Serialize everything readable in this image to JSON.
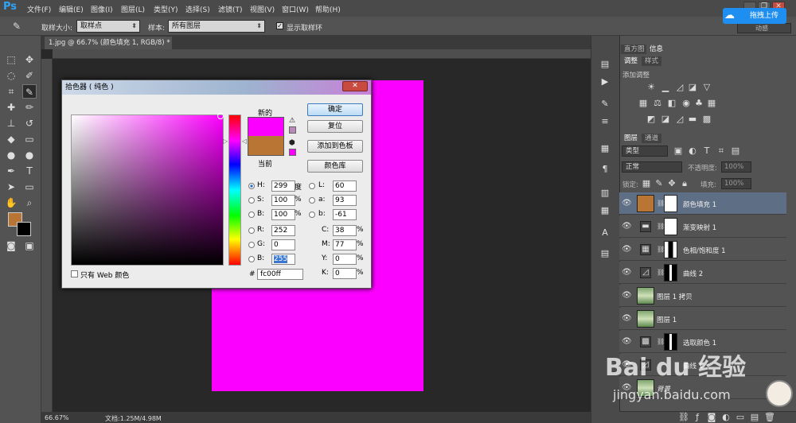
{
  "app": {
    "logo": "Ps"
  },
  "menu": [
    "文件(F)",
    "编辑(E)",
    "图像(I)",
    "图层(L)",
    "类型(Y)",
    "选择(S)",
    "滤镜(T)",
    "视图(V)",
    "窗口(W)",
    "帮助(H)"
  ],
  "window_buttons": [
    "_",
    "❐",
    "✕"
  ],
  "upload": {
    "label": "拖拽上传"
  },
  "options": {
    "sample_size_label": "取样大小:",
    "sample_size_value": "取样点",
    "sample_label": "样本:",
    "sample_value": "所有图层",
    "show_ring_label": "显示取样环",
    "workspace": "动感"
  },
  "document": {
    "tab": "1.jpg @ 66.7% (颜色填充 1, RGB/8) *",
    "zoom": "66.67%",
    "doc_size": "文档:1.25M/4.98M"
  },
  "panels": {
    "tabs_top": [
      "直方图",
      "信息"
    ],
    "tabs_adj": [
      "调整",
      "样式"
    ],
    "adj_title": "添加调整",
    "tabs_layers": [
      "图层",
      "通道"
    ],
    "filter_kind": "类型",
    "blend_mode": "正常",
    "opacity_label": "不透明度:",
    "opacity_value": "100%",
    "lock_label": "锁定:",
    "fill_label": "填充:",
    "fill_value": "100%",
    "layers": [
      {
        "name": "颜色填充 1",
        "selected": true
      },
      {
        "name": "渐变映射 1",
        "selected": false
      },
      {
        "name": "色相/饱和度 1",
        "selected": false
      },
      {
        "name": "曲线 2",
        "selected": false
      },
      {
        "name": "图层 1 拷贝",
        "selected": false
      },
      {
        "name": "图层 1",
        "selected": false
      },
      {
        "name": "选取颜色 1",
        "selected": false
      },
      {
        "name": "曲线 1",
        "selected": false
      },
      {
        "name": "背景",
        "selected": false
      }
    ]
  },
  "picker": {
    "title": "拾色器 ( 纯色 )",
    "new_label": "新的",
    "current_label": "当前",
    "ok": "确定",
    "reset": "复位",
    "add_swatch": "添加到色板",
    "color_libraries": "颜色库",
    "web_only": "只有 Web 颜色",
    "hsb": [
      {
        "k": "H:",
        "v": "299",
        "u": "度"
      },
      {
        "k": "S:",
        "v": "100",
        "u": "%"
      },
      {
        "k": "B:",
        "v": "100",
        "u": "%"
      }
    ],
    "rgb": [
      {
        "k": "R:",
        "v": "252"
      },
      {
        "k": "G:",
        "v": "0"
      },
      {
        "k": "B:",
        "v": "255"
      }
    ],
    "lab": [
      {
        "k": "L:",
        "v": "60"
      },
      {
        "k": "a:",
        "v": "93"
      },
      {
        "k": "b:",
        "v": "-61"
      }
    ],
    "cmyk": [
      {
        "k": "C:",
        "v": "38",
        "u": "%"
      },
      {
        "k": "M:",
        "v": "77",
        "u": "%"
      },
      {
        "k": "Y:",
        "v": "0",
        "u": "%"
      },
      {
        "k": "K:",
        "v": "0",
        "u": "%"
      }
    ],
    "hex": "fc00ff",
    "new_color": "#fc00ff",
    "current_color": "#b97533"
  },
  "watermark": {
    "brand": "Bai du 经验",
    "url": "jingyan.baidu.com"
  }
}
